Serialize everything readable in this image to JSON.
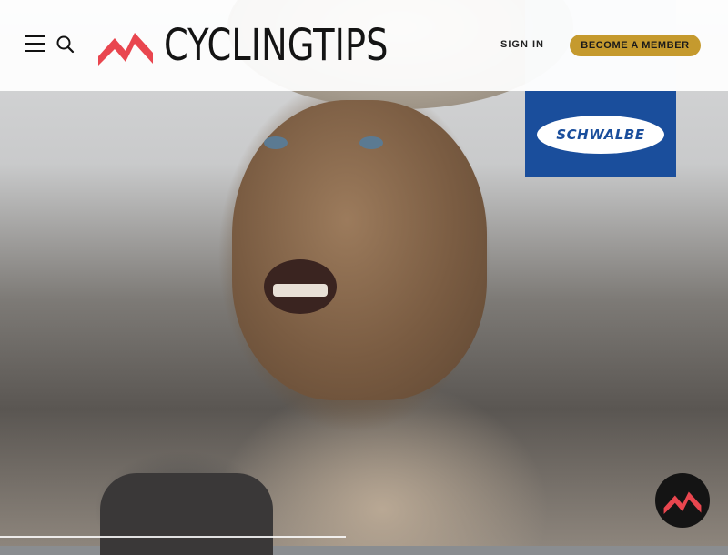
{
  "header": {
    "brand_name": "CYCLINGTIPS",
    "sign_in_label": "SIGN IN",
    "member_label": "BECOME A MEMBER",
    "menu_icon": "hamburger-menu-icon",
    "search_icon": "search-icon"
  },
  "ad": {
    "brand": "SCHWALBE",
    "color": "#1a4e9c"
  },
  "colors": {
    "brand_red": "#e9464f",
    "member_button": "#c59a2e",
    "header_bg": "#ffffff"
  },
  "hero": {
    "image_subject": "mud-covered cyclist"
  }
}
